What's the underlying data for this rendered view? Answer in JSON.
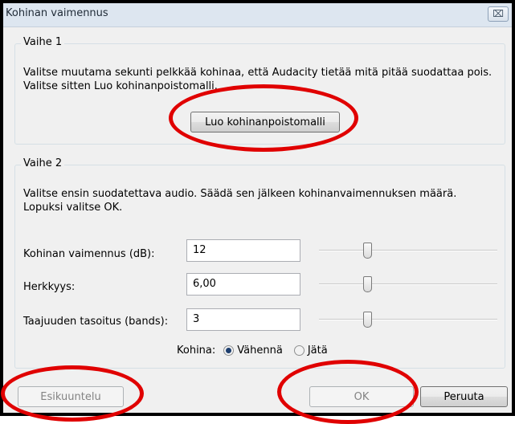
{
  "window": {
    "title": "Kohinan vaimennus",
    "close_glyph": "⌧"
  },
  "step1": {
    "legend": "Vaihe 1",
    "instructions_line1": "Valitse muutama sekunti pelkkää kohinaa, että Audacity tietää mitä pitää suodattaa pois.",
    "instructions_line2": "Valitse sitten Luo kohinanpoistomalli.",
    "button_label": "Luo kohinanpoistomalli"
  },
  "step2": {
    "legend": "Vaihe 2",
    "instructions_line1": "Valitse ensin suodatettava audio. Säädä sen jälkeen kohinanvaimennuksen määrä.",
    "instructions_line2": "Lopuksi valitse OK.",
    "fields": [
      {
        "label": "Kohinan vaimennus (dB):",
        "value": "12",
        "slider_fraction": 0.27
      },
      {
        "label": "Herkkyys:",
        "value": "6,00",
        "slider_fraction": 0.27
      },
      {
        "label": "Taajuuden tasoitus (bands):",
        "value": "3",
        "slider_fraction": 0.27
      }
    ],
    "noise_label": "Kohina:",
    "radio_options": [
      {
        "label": "Vähennä",
        "selected": true
      },
      {
        "label": "Jätä",
        "selected": false
      }
    ]
  },
  "footer": {
    "preview_label": "Esikuuntelu",
    "ok_label": "OK",
    "cancel_label": "Peruuta"
  },
  "annotations": {
    "highlight_color": "#e00000"
  }
}
